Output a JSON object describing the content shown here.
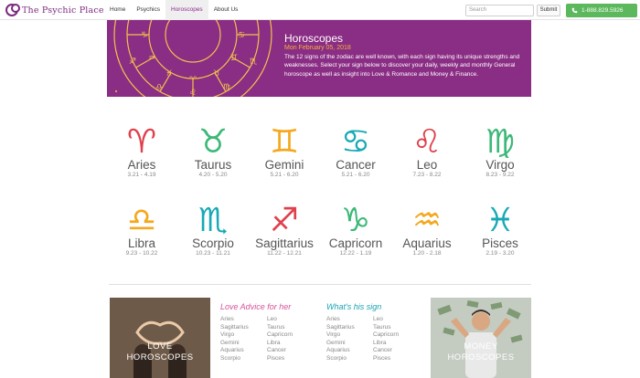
{
  "header": {
    "logo_text": "The Psychic Place",
    "nav": [
      "Home",
      "Psychics",
      "Horoscopes",
      "About Us"
    ],
    "active_nav": "Horoscopes",
    "search_placeholder": "Search",
    "submit_label": "Submit",
    "phone": "1-888.829.5926",
    "phone_color": "#5cb85c"
  },
  "banner": {
    "title": "Horoscopes",
    "date": "Mon February 05, 2018",
    "description": "The 12 signs of the zodiac are well known, with each sign having its unique strengths and weaknesses. Select your sign below to discover your daily, weekly and monthly General horoscope as well as insight into Love & Romance and Money & Finance.",
    "background": "#8a2d84",
    "accent": "#f5b23b"
  },
  "signs": [
    {
      "name": "Aries",
      "dates": "3.21 - 4.19",
      "symbol": "♈",
      "color": "#e0404c",
      "icon": "aries-icon"
    },
    {
      "name": "Taurus",
      "dates": "4.20 - 5.20",
      "symbol": "♉",
      "color": "#3cb878",
      "icon": "taurus-icon"
    },
    {
      "name": "Gemini",
      "dates": "5.21 - 6.20",
      "symbol": "♊",
      "color": "#f4a81d",
      "icon": "gemini-icon"
    },
    {
      "name": "Cancer",
      "dates": "5.21 - 6.20",
      "symbol": "♋",
      "color": "#17a9b6",
      "icon": "cancer-icon"
    },
    {
      "name": "Leo",
      "dates": "7.23 - 8.22",
      "symbol": "♌",
      "color": "#e0404c",
      "icon": "leo-icon"
    },
    {
      "name": "Virgo",
      "dates": "8.23 - 9.22",
      "symbol": "♍",
      "color": "#3cb878",
      "icon": "virgo-icon"
    },
    {
      "name": "Libra",
      "dates": "9.23 - 10.22",
      "symbol": "♎",
      "color": "#f4a81d",
      "icon": "libra-icon"
    },
    {
      "name": "Scorpio",
      "dates": "10.23 - 11.21",
      "symbol": "♏",
      "color": "#17a9b6",
      "icon": "scorpio-icon"
    },
    {
      "name": "Sagittarius",
      "dates": "11.22 - 12.21",
      "symbol": "♐",
      "color": "#e0404c",
      "icon": "sagittarius-icon"
    },
    {
      "name": "Capricorn",
      "dates": "12.22 - 1.19",
      "symbol": "♑",
      "color": "#3cb878",
      "icon": "capricorn-icon"
    },
    {
      "name": "Aquarius",
      "dates": "1.20 - 2.18",
      "symbol": "♒",
      "color": "#f4a81d",
      "icon": "aquarius-icon"
    },
    {
      "name": "Pisces",
      "dates": "2.19 - 3.20",
      "symbol": "♓",
      "color": "#17a9b6",
      "icon": "pisces-icon"
    }
  ],
  "bottom": {
    "love_promo_label": [
      "LOVE",
      "HOROSCOPES"
    ],
    "money_promo_label": [
      "MONEY",
      "HOROSCOPES"
    ],
    "love_advice_title": "Love Advice for her",
    "his_sign_title": "What's his sign",
    "love_advice_col1": [
      "Aries",
      "Sagittarius",
      "Virgo",
      "Gemini",
      "Aquarius",
      "Scorpio"
    ],
    "love_advice_col2": [
      "Leo",
      "Taurus",
      "Capricorn",
      "Libra",
      "Cancer",
      "Pisces"
    ],
    "his_sign_col1": [
      "Aries",
      "Sagittarius",
      "Virgo",
      "Gemini",
      "Aquarius",
      "Scorpio"
    ],
    "his_sign_col2": [
      "Leo",
      "Taurus",
      "Capricorn",
      "Libra",
      "Cancer",
      "Pisces"
    ]
  }
}
